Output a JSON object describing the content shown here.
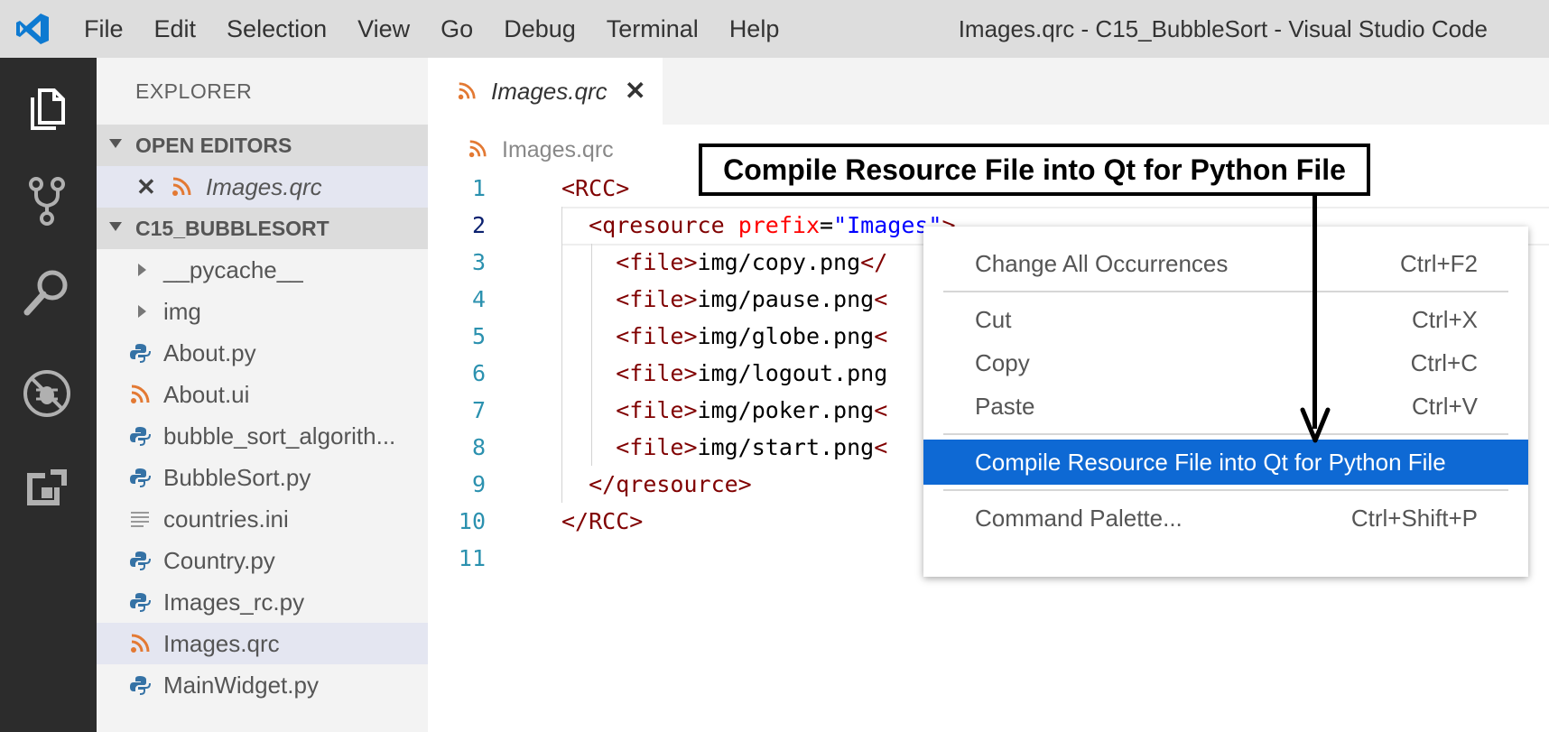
{
  "window": {
    "title": "Images.qrc - C15_BubbleSort - Visual Studio Code"
  },
  "menu": [
    "File",
    "Edit",
    "Selection",
    "View",
    "Go",
    "Debug",
    "Terminal",
    "Help"
  ],
  "sidebar": {
    "title": "EXPLORER",
    "open_editors": {
      "header": "OPEN EDITORS",
      "items": [
        {
          "label": "Images.qrc",
          "icon": "rss-icon"
        }
      ]
    },
    "project": {
      "header": "C15_BUBBLESORT",
      "items": [
        {
          "label": "__pycache__",
          "icon": "folder-chevron-icon"
        },
        {
          "label": "img",
          "icon": "folder-chevron-icon"
        },
        {
          "label": "About.py",
          "icon": "python-icon"
        },
        {
          "label": "About.ui",
          "icon": "rss-icon"
        },
        {
          "label": "bubble_sort_algorith...",
          "icon": "python-icon"
        },
        {
          "label": "BubbleSort.py",
          "icon": "python-icon"
        },
        {
          "label": "countries.ini",
          "icon": "lines-icon"
        },
        {
          "label": "Country.py",
          "icon": "python-icon"
        },
        {
          "label": "Images_rc.py",
          "icon": "python-icon"
        },
        {
          "label": "Images.qrc",
          "icon": "rss-icon",
          "selected": true
        },
        {
          "label": "MainWidget.py",
          "icon": "python-icon"
        }
      ]
    }
  },
  "editor": {
    "tab": {
      "label": "Images.qrc",
      "close": "✕"
    },
    "breadcrumb": "Images.qrc",
    "lines": [
      {
        "n": "1",
        "parts": [
          {
            "t": "<RCC>",
            "c": "tag"
          }
        ]
      },
      {
        "n": "2",
        "parts": [
          {
            "t": "  ",
            "c": "plain"
          },
          {
            "t": "<qresource ",
            "c": "tag"
          },
          {
            "t": "prefix",
            "c": "attr"
          },
          {
            "t": "=",
            "c": "plain"
          },
          {
            "t": "\"Images\"",
            "c": "str"
          },
          {
            "t": ">",
            "c": "tag"
          }
        ]
      },
      {
        "n": "3",
        "parts": [
          {
            "t": "    ",
            "c": "plain"
          },
          {
            "t": "<file>",
            "c": "tag"
          },
          {
            "t": "img/copy.png",
            "c": "plain"
          },
          {
            "t": "</",
            "c": "tag"
          }
        ]
      },
      {
        "n": "4",
        "parts": [
          {
            "t": "    ",
            "c": "plain"
          },
          {
            "t": "<file>",
            "c": "tag"
          },
          {
            "t": "img/pause.png",
            "c": "plain"
          },
          {
            "t": "<",
            "c": "tag"
          }
        ]
      },
      {
        "n": "5",
        "parts": [
          {
            "t": "    ",
            "c": "plain"
          },
          {
            "t": "<file>",
            "c": "tag"
          },
          {
            "t": "img/globe.png",
            "c": "plain"
          },
          {
            "t": "<",
            "c": "tag"
          }
        ]
      },
      {
        "n": "6",
        "parts": [
          {
            "t": "    ",
            "c": "plain"
          },
          {
            "t": "<file>",
            "c": "tag"
          },
          {
            "t": "img/logout.png",
            "c": "plain"
          }
        ]
      },
      {
        "n": "7",
        "parts": [
          {
            "t": "    ",
            "c": "plain"
          },
          {
            "t": "<file>",
            "c": "tag"
          },
          {
            "t": "img/poker.png",
            "c": "plain"
          },
          {
            "t": "<",
            "c": "tag"
          }
        ]
      },
      {
        "n": "8",
        "parts": [
          {
            "t": "    ",
            "c": "plain"
          },
          {
            "t": "<file>",
            "c": "tag"
          },
          {
            "t": "img/start.png",
            "c": "plain"
          },
          {
            "t": "<",
            "c": "tag"
          }
        ]
      },
      {
        "n": "9",
        "parts": [
          {
            "t": "  ",
            "c": "plain"
          },
          {
            "t": "</qresource>",
            "c": "tag"
          }
        ]
      },
      {
        "n": "10",
        "parts": [
          {
            "t": "</RCC>",
            "c": "tag"
          }
        ]
      },
      {
        "n": "11",
        "parts": []
      }
    ]
  },
  "context_menu": {
    "items": [
      {
        "label": "Change All Occurrences",
        "shortcut": "Ctrl+F2"
      },
      {
        "label": "Cut",
        "shortcut": "Ctrl+X"
      },
      {
        "label": "Copy",
        "shortcut": "Ctrl+C"
      },
      {
        "label": "Paste",
        "shortcut": "Ctrl+V"
      },
      {
        "label": "Compile Resource File into Qt for Python File",
        "shortcut": "",
        "highlighted": true
      },
      {
        "label": "Command Palette...",
        "shortcut": "Ctrl+Shift+P"
      }
    ]
  },
  "annotation": {
    "label": "Compile Resource File into Qt for Python File"
  },
  "colors": {
    "accent": "#0e69d4",
    "activity_bar": "#2c2c2c",
    "tag": "#800000",
    "attr": "#ff0000",
    "string": "#0000ff",
    "rss_orange": "#e37933",
    "python_blue": "#3572a5"
  }
}
